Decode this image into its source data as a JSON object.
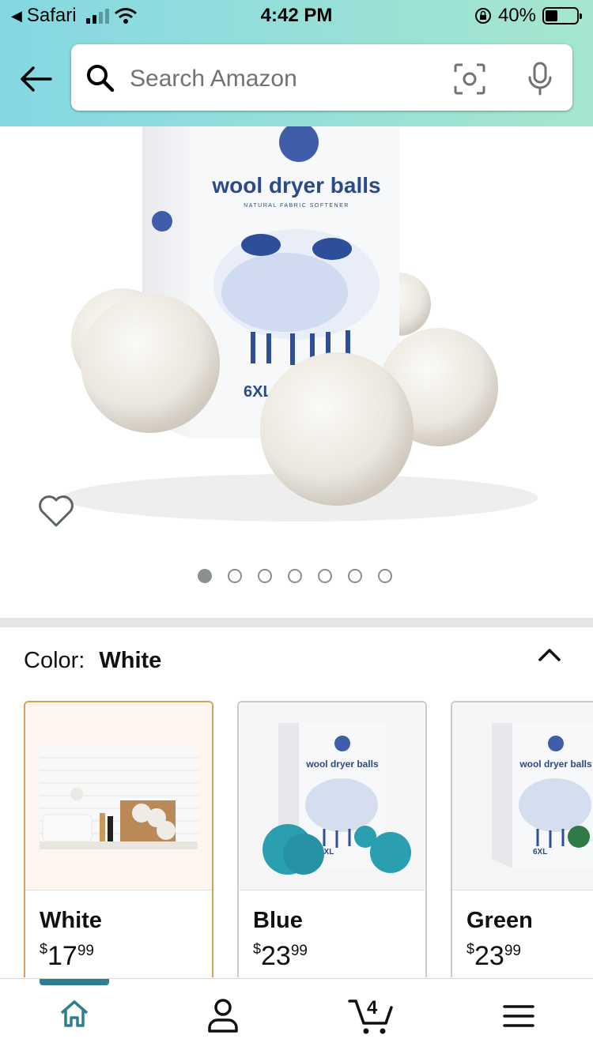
{
  "status_bar": {
    "back_app": "Safari",
    "time": "4:42 PM",
    "battery": "40%",
    "battery_level": 0.4
  },
  "search": {
    "placeholder": "Search Amazon"
  },
  "product": {
    "box_title": "wool dryer balls",
    "box_subtitle": "NATURAL FABRIC SOFTENER",
    "box_badge": "6XL"
  },
  "carousel": {
    "count": 7,
    "active": 0
  },
  "variation": {
    "label": "Color:",
    "selected": "White"
  },
  "options": [
    {
      "name": "White",
      "currency": "$",
      "dollars": "17",
      "cents": "99",
      "selected": true,
      "ball_color": "#efece6"
    },
    {
      "name": "Blue",
      "currency": "$",
      "dollars": "23",
      "cents": "99",
      "selected": false,
      "ball_color": "#2a9fb0"
    },
    {
      "name": "Green",
      "currency": "$",
      "dollars": "23",
      "cents": "99",
      "selected": false,
      "ball_color": "#2f7a45"
    }
  ],
  "thumb_box": {
    "title": "wool dryer balls",
    "badge": "6XL"
  },
  "tab_bar": {
    "cart_count": "4",
    "items": [
      "home-icon",
      "account-icon",
      "cart-icon",
      "menu-icon"
    ]
  },
  "colors": {
    "accent": "#2f7d8e",
    "selected_border": "#d4a15a"
  }
}
